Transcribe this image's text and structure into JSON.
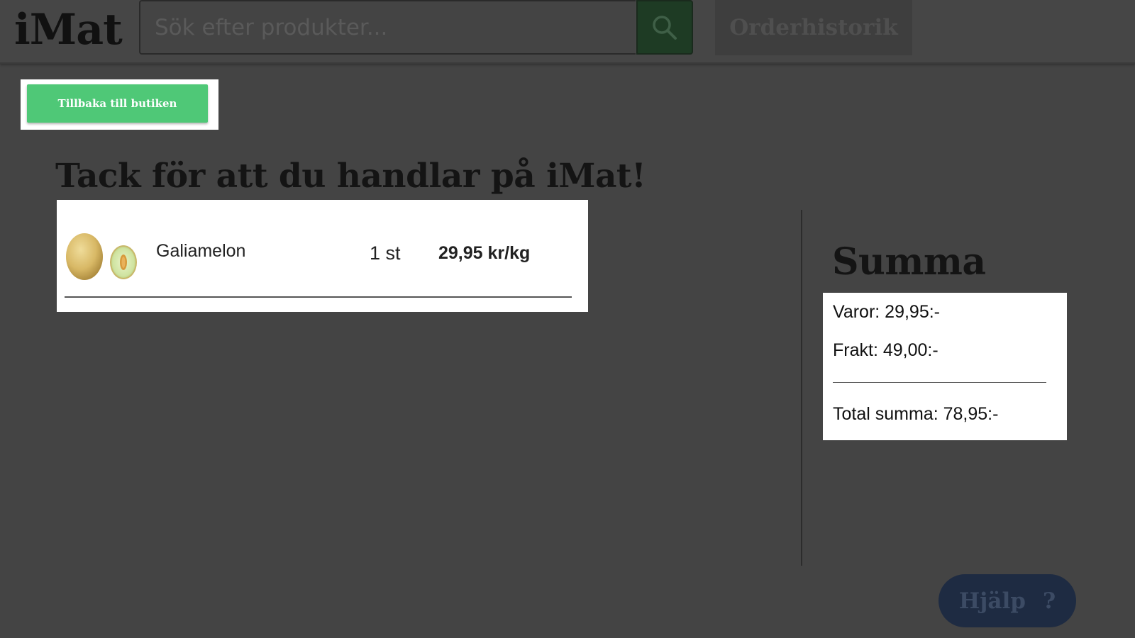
{
  "header": {
    "logo": "iMat",
    "search": {
      "placeholder": "Sök efter produkter...",
      "value": "",
      "icon": "search-icon"
    },
    "order_history_label": "Orderhistorik"
  },
  "back_button_label": "Tillbaka till butiken",
  "page_title": "Tack för att du handlar på iMat!",
  "order_items": [
    {
      "name": "Galiamelon",
      "quantity": "1 st",
      "price": "29,95 kr/kg",
      "image": "galia-melon-image"
    }
  ],
  "summary": {
    "title": "Summa",
    "goods": "Varor: 29,95:-",
    "shipping": "Frakt: 49,00:-",
    "total": "Total summa: 78,95:-"
  },
  "help": {
    "label": "Hjälp",
    "icon_text": "?"
  },
  "colors": {
    "background": "#444444",
    "accent_green": "#4fc877",
    "search_button": "#1e3b24",
    "help_button": "#1e2b42"
  }
}
